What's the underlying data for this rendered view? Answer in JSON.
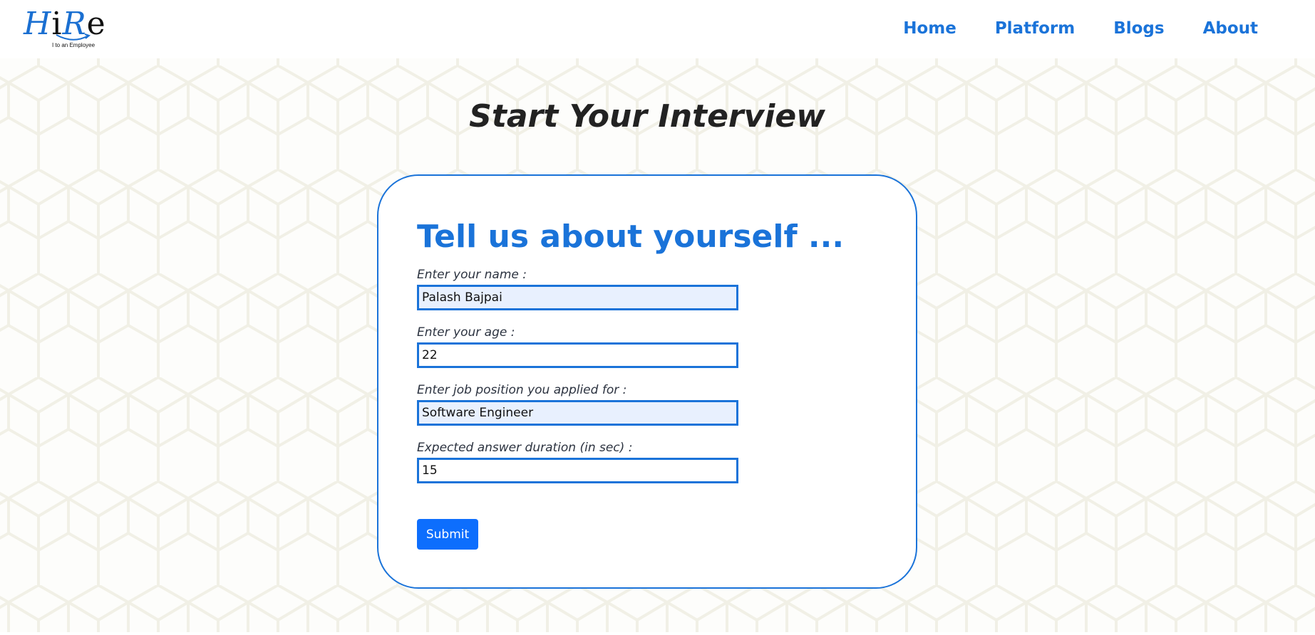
{
  "logo": {
    "letters": [
      "H",
      "i",
      "R",
      "e"
    ],
    "tagline": "I to an Employee",
    "colors": {
      "blue": "#1a6fd1",
      "black": "#111111"
    }
  },
  "nav": {
    "items": [
      {
        "label": "Home"
      },
      {
        "label": "Platform"
      },
      {
        "label": "Blogs"
      },
      {
        "label": "About"
      }
    ]
  },
  "page": {
    "title": "Start Your Interview"
  },
  "form": {
    "heading": "Tell us about yourself ...",
    "fields": [
      {
        "label": "Enter your name :",
        "value": "Palash Bajpai"
      },
      {
        "label": "Enter your age :",
        "value": "22"
      },
      {
        "label": "Enter job position you applied for :",
        "value": "Software Engineer"
      },
      {
        "label": "Expected answer duration (in sec) :",
        "value": "15"
      }
    ],
    "submit_label": "Submit"
  },
  "colors": {
    "accent": "#1a73d9",
    "button": "#0d6efd",
    "autofill": "#e8f0fe",
    "background_pattern": "#f3f2ea"
  }
}
